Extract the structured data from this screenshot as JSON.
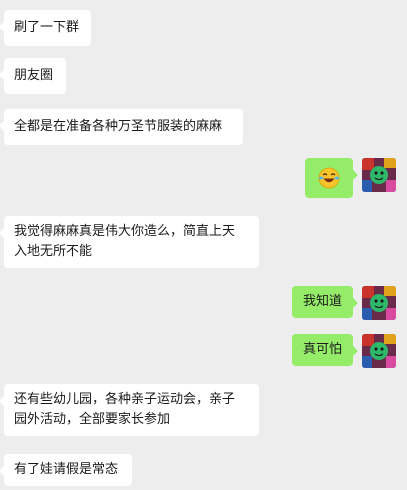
{
  "messages": [
    {
      "side": "left",
      "text": "刷了一下群"
    },
    {
      "side": "left",
      "text": "朋友圈"
    },
    {
      "side": "left",
      "text": "全都是在准备各种万圣节服装的麻麻"
    },
    {
      "side": "right",
      "emoji": "laughing-crying-emoji-icon"
    },
    {
      "side": "left",
      "lines": [
        "我觉得麻麻真是伟大你造么，简直上天",
        "入地无所不能"
      ]
    },
    {
      "side": "right",
      "text": "我知道"
    },
    {
      "side": "right",
      "text": "真可怕"
    },
    {
      "side": "left",
      "lines": [
        "还有些幼儿园，各种亲子运动会，亲子",
        "园外活动，全部要家长参加"
      ]
    },
    {
      "side": "left",
      "text": "有了娃请假是常态"
    }
  ],
  "colors": {
    "background": "#ededed",
    "left_bubble": "#ffffff",
    "right_bubble": "#95ec69"
  }
}
